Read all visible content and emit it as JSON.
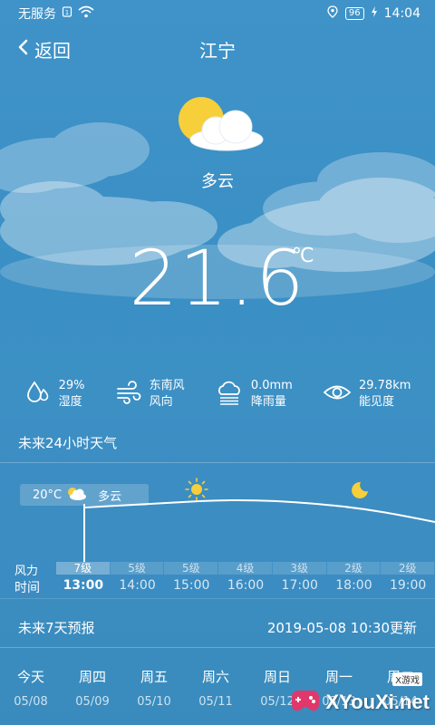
{
  "status_bar": {
    "carrier": "无服务",
    "battery": "96",
    "time": "14:04"
  },
  "header": {
    "back_label": "返回",
    "city": "江宁"
  },
  "current": {
    "condition": "多云",
    "temperature": "21.6",
    "unit": "℃",
    "icon": "partly-cloudy-icon"
  },
  "stats": [
    {
      "icon": "humidity-icon",
      "value": "29%",
      "label": "湿度"
    },
    {
      "icon": "wind-icon",
      "value": "东南风",
      "label": "风向"
    },
    {
      "icon": "rain-icon",
      "value": "0.0mm",
      "label": "降雨量"
    },
    {
      "icon": "visibility-icon",
      "value": "29.78km",
      "label": "能见度"
    }
  ],
  "hourly": {
    "title": "未来24小时天气",
    "current_temp": "20°C",
    "current_condition": "多云",
    "wind_label": "风力",
    "time_label": "时间",
    "wind": [
      "7级",
      "5级",
      "5级",
      "4级",
      "3级",
      "2级",
      "2级"
    ],
    "times": [
      "13:00",
      "14:00",
      "15:00",
      "16:00",
      "17:00",
      "18:00",
      "19:00"
    ]
  },
  "forecast": {
    "title": "未来7天预报",
    "updated": "2019-05-08 10:30更新",
    "days": [
      {
        "name": "今天",
        "date": "05/08"
      },
      {
        "name": "周四",
        "date": "05/09"
      },
      {
        "name": "周五",
        "date": "05/10"
      },
      {
        "name": "周六",
        "date": "05/11"
      },
      {
        "name": "周日",
        "date": "05/12"
      },
      {
        "name": "周一",
        "date": "05/13"
      },
      {
        "name": "周二",
        "date": "05/14"
      }
    ]
  },
  "watermark": {
    "text": "XYouXi.net",
    "badge": "X游戏"
  },
  "colors": {
    "background": "#3f93c9",
    "sun": "#f6cf3a"
  }
}
